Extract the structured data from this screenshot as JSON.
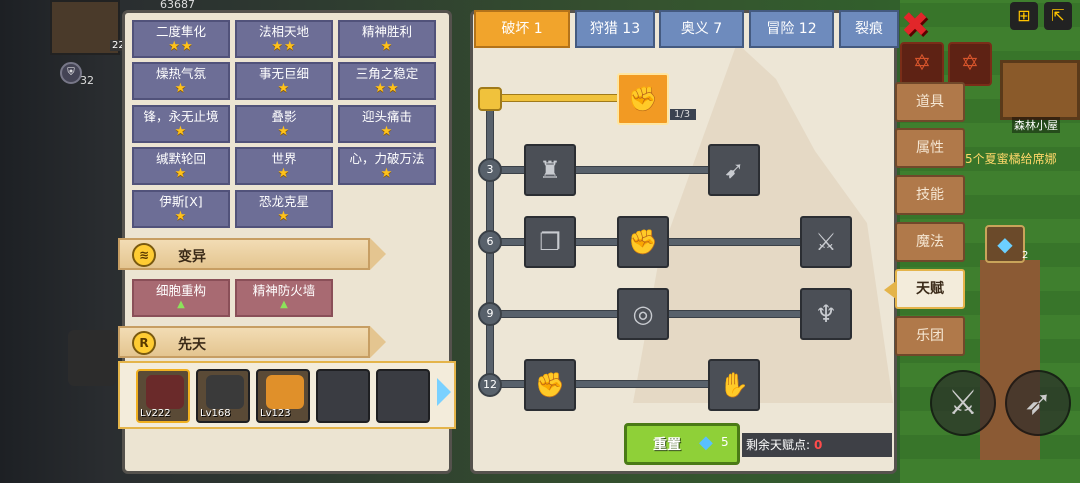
{
  "hud": {
    "top_number": "63687",
    "level_badge": "22",
    "shield_value": "32"
  },
  "world": {
    "quest_text": "5个夏蜜橘给席娜",
    "house_label": "森林小屋",
    "gem_slot_count": "2"
  },
  "left_panel": {
    "talents": [
      {
        "name": "二度隼化",
        "stars": "★★"
      },
      {
        "name": "法相天地",
        "stars": "★★"
      },
      {
        "name": "精神胜利",
        "stars": "★"
      },
      {
        "name": "燥热气氛",
        "stars": "★"
      },
      {
        "name": "事无巨细",
        "stars": "★"
      },
      {
        "name": "三角之稳定",
        "stars": "★★"
      },
      {
        "name": "锋，永无止境",
        "stars": "★"
      },
      {
        "name": "叠影",
        "stars": "★"
      },
      {
        "name": "迎头痛击",
        "stars": "★"
      },
      {
        "name": "缄默轮回",
        "stars": "★"
      },
      {
        "name": "世界",
        "stars": "★"
      },
      {
        "name": "心，力破万法",
        "stars": "★"
      },
      {
        "name": "伊斯[X]",
        "stars": "★"
      },
      {
        "name": "恐龙克星",
        "stars": "★"
      }
    ],
    "mutation_title": "变异",
    "mutations": [
      {
        "name": "细胞重构",
        "mark": "▲"
      },
      {
        "name": "精神防火墙",
        "mark": "▲"
      }
    ],
    "innate_title": "先天",
    "innate_icon": "R",
    "characters": [
      {
        "level": "Lv222",
        "color": "#6a2a2a"
      },
      {
        "level": "Lv168",
        "color": "#3a3a3a"
      },
      {
        "level": "Lv123",
        "color": "#e0902a"
      },
      {
        "level": "",
        "color": ""
      },
      {
        "level": "",
        "color": ""
      }
    ]
  },
  "tabs": [
    {
      "label": "破坏 1"
    },
    {
      "label": "狩猎 13"
    },
    {
      "label": "奥义 7"
    },
    {
      "label": "冒险 12"
    },
    {
      "label": "裂痕"
    }
  ],
  "tree": {
    "tiers": [
      "3",
      "6",
      "9",
      "12"
    ],
    "top_node_count": "1/3"
  },
  "reset": {
    "label": "重置",
    "cost": "5"
  },
  "remaining": {
    "label": "剩余天赋点:",
    "value": "0"
  },
  "side_menu": [
    "道具",
    "属性",
    "技能",
    "魔法",
    "天赋",
    "乐团"
  ],
  "colors": {
    "active_tab": "#f1a42c",
    "tab": "#6e8bbd",
    "reset_button": "#8fd038",
    "star": "#ffc21a"
  }
}
